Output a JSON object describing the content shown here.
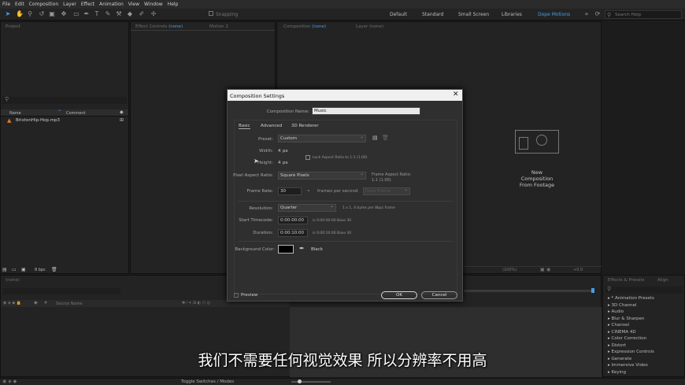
{
  "menu": [
    "File",
    "Edit",
    "Composition",
    "Layer",
    "Effect",
    "Animation",
    "View",
    "Window",
    "Help"
  ],
  "toolbar": {
    "snapping": "Snapping",
    "workspaces": [
      "Default",
      "Standard",
      "Small Screen",
      "Libraries",
      "Dope Motions"
    ],
    "search_placeholder": "Search Help",
    "accent": "#4a9de8"
  },
  "project": {
    "title": "Project",
    "col_name": "Name",
    "col_comment": "Comment",
    "file": "BrixtonHip-Hop.mp3",
    "bpc": "8 bpc"
  },
  "effect_controls": {
    "title": "Effect Controls",
    "none": "(none)",
    "motion": "Motion 2"
  },
  "composition": {
    "title": "Composition",
    "none": "(none)",
    "layer": "Layer (none)",
    "new_line1": "New",
    "new_line2": "Composition",
    "new_line3": "From Footage",
    "zoom": "(100%)",
    "plus": "+0.0"
  },
  "timeline": {
    "title": "(none)",
    "source_name": "Source Name",
    "toggle": "Toggle Switches / Modes"
  },
  "effects": {
    "title": "Effects & Presets",
    "align": "Align",
    "items": [
      "* Animation Presets",
      "3D Channel",
      "Audio",
      "Blur & Sharpen",
      "Channel",
      "CINEMA 4D",
      "Color Correction",
      "Distort",
      "Expression Controls",
      "Generate",
      "Immersive Video",
      "Keying"
    ]
  },
  "dialog": {
    "title": "Composition Settings",
    "comp_name_label": "Composition Name:",
    "comp_name": "Music",
    "tabs": [
      "Basic",
      "Advanced",
      "3D Renderer"
    ],
    "preset_label": "Preset:",
    "preset": "Custom",
    "width_label": "Width:",
    "width": "4",
    "height_label": "Height:",
    "height": "4",
    "px": "px",
    "lock_aspect": "Lock Aspect Ratio to 1:1 (1.00)",
    "par_label": "Pixel Aspect Ratio:",
    "par": "Square Pixels",
    "frame_aspect_label": "Frame Aspect Ratio:",
    "frame_aspect": "1:1 (1.00)",
    "fps_label": "Frame Rate:",
    "fps": "30",
    "fps_unit": "frames per second",
    "drop_frame": "Drop Frame",
    "res_label": "Resolution:",
    "res": "Quarter",
    "res_info": "1 x 1, 4 bytes per 8bpc frame",
    "start_label": "Start Timecode:",
    "start": "0:00:00:00",
    "start_info": "is 0:00:00:00  Base 30",
    "dur_label": "Duration:",
    "dur": "0:00:10:00",
    "dur_info": "is 0:00:10:00  Base 30",
    "bg_label": "Background Color:",
    "bg_name": "Black",
    "bg_color": "#000000",
    "preview": "Preview",
    "ok": "OK",
    "cancel": "Cancel"
  },
  "subtitle": "我们不需要任何视觉效果 所以分辨率不用高"
}
